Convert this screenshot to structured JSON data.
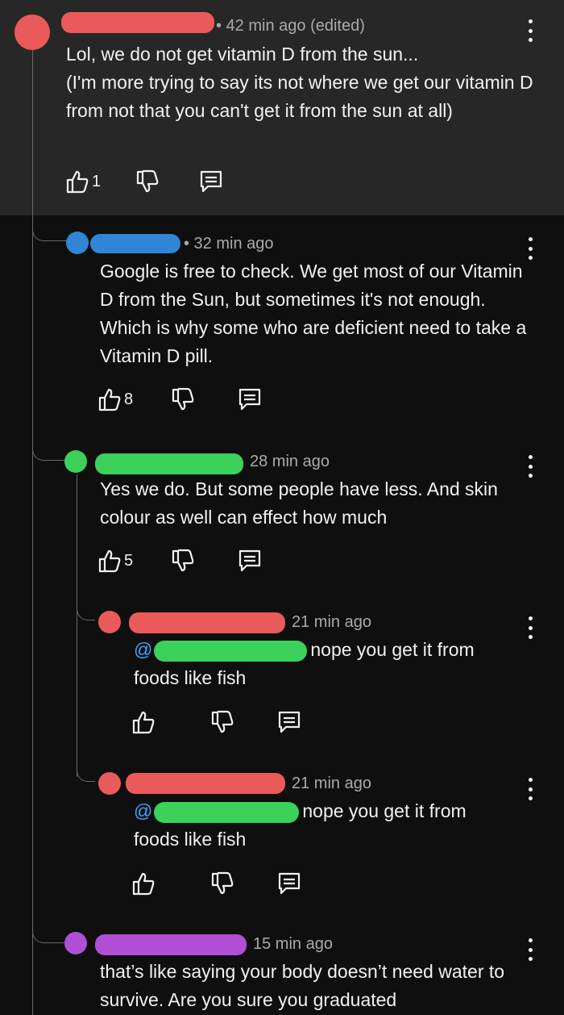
{
  "colors": {
    "background": "#0f0f0f",
    "highlight_background": "#272727",
    "text": "#f1f1f1",
    "meta_text": "#aaaaaa",
    "mention": "#3ea6ff",
    "redaction_red": "#eb5a5a",
    "redaction_blue": "#2f86d6",
    "redaction_green": "#3bd15a",
    "redaction_purple": "#b04fd6"
  },
  "icons": {
    "like": "thumb-up-icon",
    "dislike": "thumb-down-icon",
    "reply": "reply-icon",
    "more": "more-vert-icon"
  },
  "comments": [
    {
      "time": "• 42 min ago (edited)",
      "lines": [
        "Lol, we do not get vitamin D from the sun...",
        "(I'm more trying to say its not where we get our vitamin D from not that you can't get it from the sun at all)"
      ],
      "likes": "1"
    },
    {
      "time": "• 32 min ago",
      "lines": [
        "Google is free to check. We get most of our Vitamin D from the Sun, but sometimes it's not enough. Which is why some who are deficient need to take a Vitamin D pill."
      ],
      "likes": "8"
    },
    {
      "time": "28 min ago",
      "lines": [
        "Yes we do. But some people have less. And skin colour as well can effect how much"
      ],
      "likes": "5"
    },
    {
      "time": "21 min ago",
      "mention_prefix": "@",
      "after_mention": "nope you get it from",
      "second_line": "foods like fish",
      "likes": ""
    },
    {
      "time": "21 min ago",
      "mention_prefix": "@",
      "after_mention": "nope you get it from",
      "second_line": "foods like fish",
      "likes": ""
    },
    {
      "time": "15 min ago",
      "lines": [
        "that’s like saying your body doesn’t need water to survive. Are you sure you graduated"
      ],
      "likes": ""
    }
  ]
}
